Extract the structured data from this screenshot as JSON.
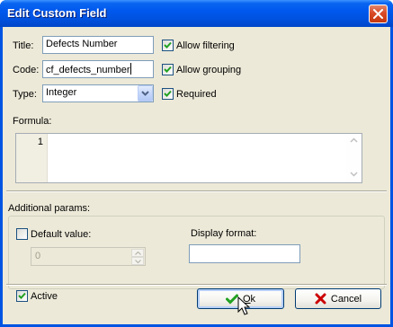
{
  "dialog": {
    "title": "Edit Custom Field",
    "close_tooltip": "Close"
  },
  "fields": {
    "title_label": "Title:",
    "title_value": "Defects Number",
    "code_label": "Code:",
    "code_value": "cf_defects_number",
    "type_label": "Type:",
    "type_value": "Integer"
  },
  "options": {
    "allow_filtering": {
      "label": "Allow filtering",
      "checked": true
    },
    "allow_grouping": {
      "label": "Allow grouping",
      "checked": true
    },
    "required": {
      "label": "Required",
      "checked": true
    }
  },
  "formula": {
    "label": "Formula:",
    "line_number": "1",
    "content": ""
  },
  "additional": {
    "label": "Additional params:",
    "default_value_label": "Default value:",
    "default_value_checked": false,
    "default_value": "0",
    "display_format_label": "Display format:",
    "display_format_value": ""
  },
  "footer": {
    "active_label": "Active",
    "active_checked": true,
    "ok_label_underlined": "O",
    "ok_label_rest": "k",
    "cancel_label": "Cancel"
  },
  "colors": {
    "titlebar": "#0054e3",
    "dialog_bg": "#ece9d8",
    "check_green": "#21a121",
    "cancel_red": "#cc0000"
  }
}
